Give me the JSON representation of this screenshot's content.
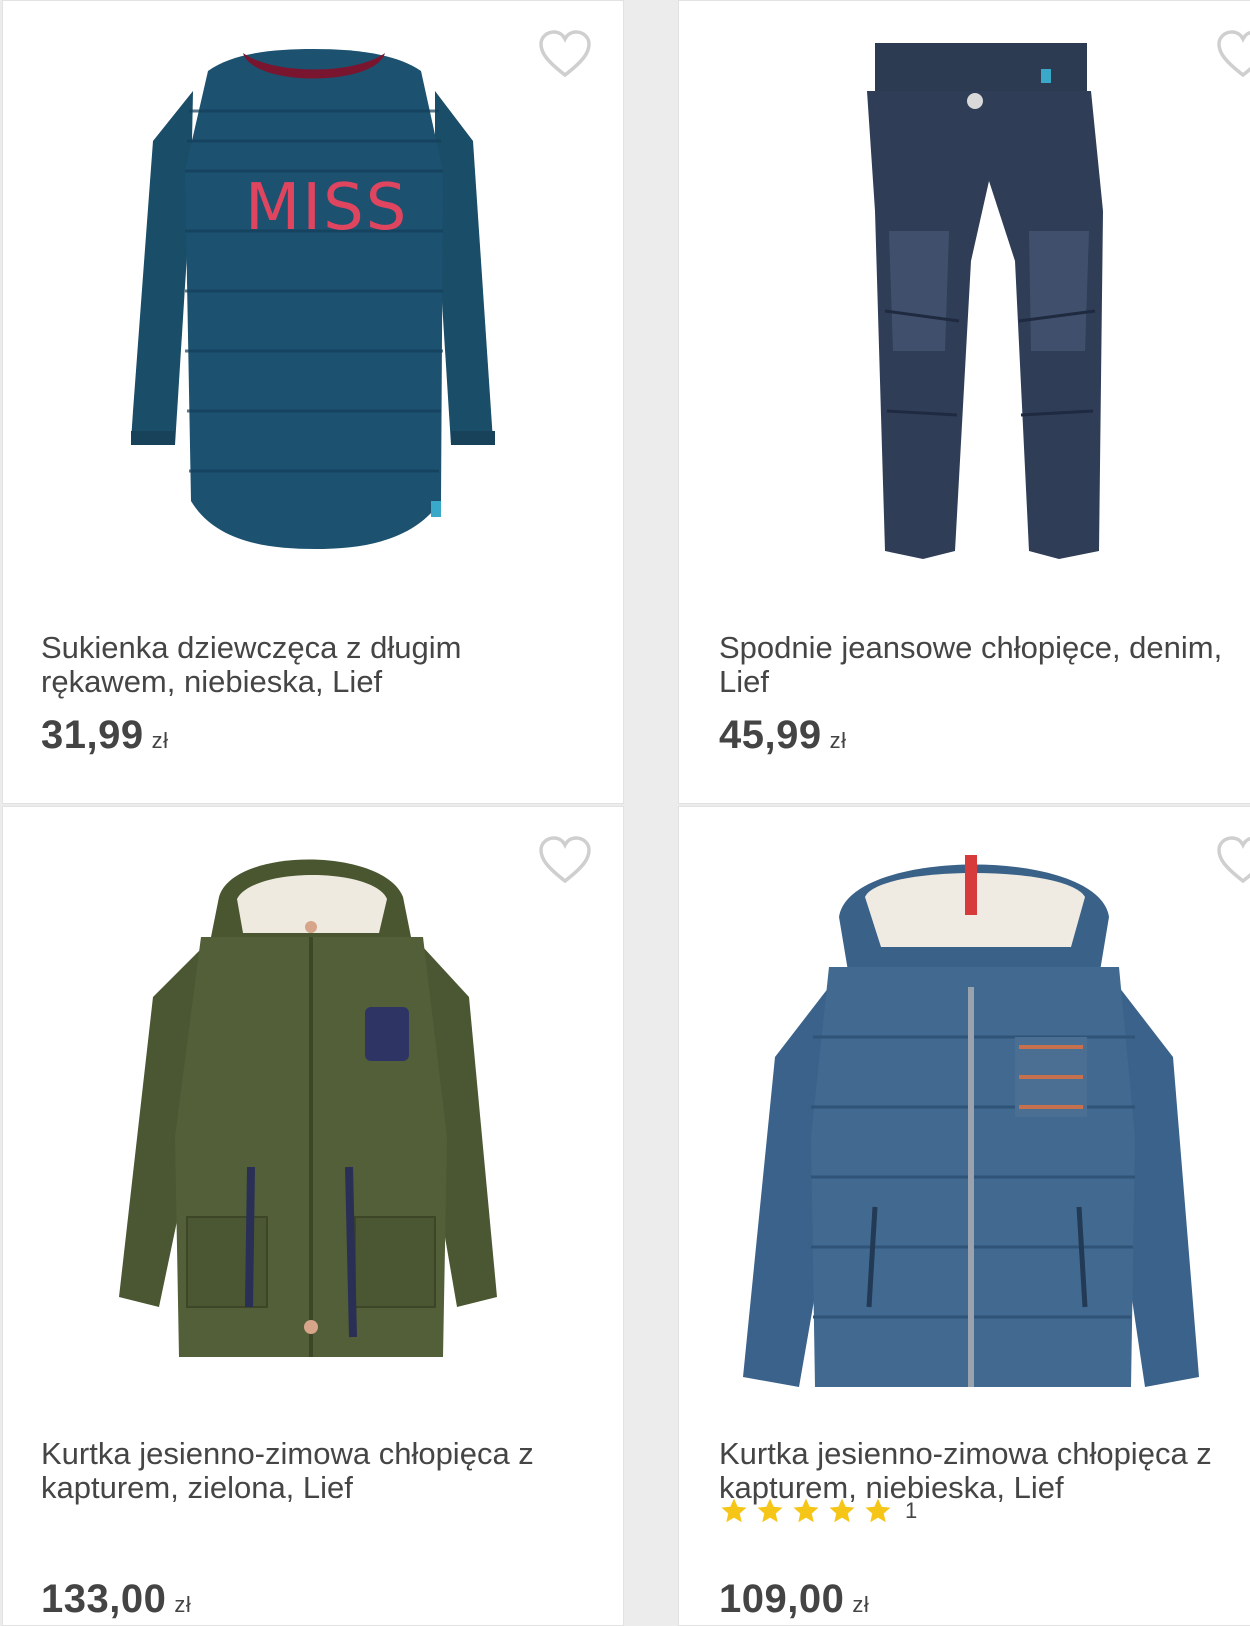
{
  "products": [
    {
      "title": "Sukienka dziewczęca z długim rękawem, niebieska, Lief",
      "price": "31,99",
      "currency": "zł"
    },
    {
      "title": "Spodnie jeansowe chłopięce, denim, Lief",
      "price": "45,99",
      "currency": "zł"
    },
    {
      "title": "Kurtka jesienno-zimowa chłopięca z kapturem, zielona, Lief",
      "price": "133,00",
      "currency": "zł"
    },
    {
      "title": "Kurtka jesienno-zimowa chłopięca z kapturem, niebieska, Lief",
      "rating": 5,
      "review_count": "1",
      "price": "109,00",
      "currency": "zł"
    }
  ],
  "icons": {
    "favorite": "heart-outline-icon",
    "rating_star": "star-icon"
  },
  "colors": {
    "star": "#f5c518",
    "heart_outline": "#cfcfcf"
  }
}
